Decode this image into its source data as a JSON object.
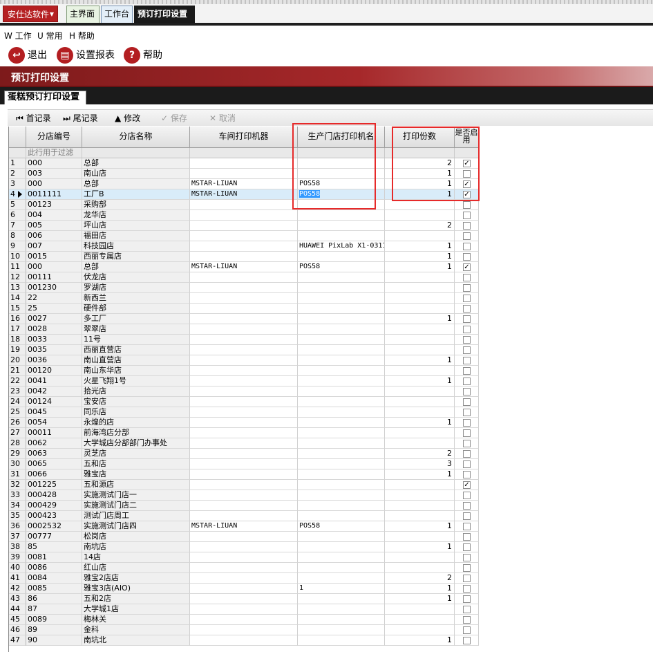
{
  "app": {
    "brand": "安仕达软件",
    "tabs": [
      "主界面",
      "工作台",
      "预订打印设置"
    ]
  },
  "menu": [
    "W 工作",
    "U 常用",
    "H 帮助"
  ],
  "toolbar": {
    "exit": "退出",
    "settings": "设置报表",
    "help": "帮助"
  },
  "page_title": "预订打印设置",
  "subtab": "蛋糕预订打印设置",
  "grid_toolbar": {
    "first": "首记录",
    "last": "尾记录",
    "edit": "修改",
    "save": "保存",
    "cancel": "取消"
  },
  "columns": {
    "code": "分店编号",
    "name": "分店名称",
    "workshop": "车间打印机器",
    "store": "生产门店打印机名",
    "copies": "打印份数",
    "enabled": "是否启用"
  },
  "filter_hint": "此行用于过滤",
  "colors": {
    "brand": "#b52022",
    "title_bar": "#8b1f20",
    "selection": "#d9ecf9",
    "highlight_box": "#e62a2a"
  },
  "rows": [
    {
      "i": "1",
      "code": "000",
      "name": "总部",
      "wp": "",
      "sp": "",
      "cnt": "2",
      "en": true
    },
    {
      "i": "2",
      "code": "003",
      "name": "南山店",
      "wp": "",
      "sp": "",
      "cnt": "1",
      "en": false
    },
    {
      "i": "3",
      "code": "000",
      "name": "总部",
      "wp": "MSTAR-LIUAN",
      "sp": "POS58",
      "cnt": "1",
      "en": true
    },
    {
      "i": "4",
      "code": "0011111",
      "name": "工厂B",
      "wp": "MSTAR-LIUAN",
      "sp": "POS58",
      "cnt": "1",
      "en": true
    },
    {
      "i": "5",
      "code": "00123",
      "name": "采购部",
      "wp": "",
      "sp": "",
      "cnt": "",
      "en": false
    },
    {
      "i": "6",
      "code": "004",
      "name": "龙华店",
      "wp": "",
      "sp": "",
      "cnt": "",
      "en": false
    },
    {
      "i": "7",
      "code": "005",
      "name": "坪山店",
      "wp": "",
      "sp": "",
      "cnt": "2",
      "en": false
    },
    {
      "i": "8",
      "code": "006",
      "name": "福田店",
      "wp": "",
      "sp": "",
      "cnt": "",
      "en": false
    },
    {
      "i": "9",
      "code": "007",
      "name": "科技园店",
      "wp": "",
      "sp": "HUAWEI PixLab X1-0311",
      "cnt": "1",
      "en": false
    },
    {
      "i": "10",
      "code": "0015",
      "name": "西丽专属店",
      "wp": "",
      "sp": "",
      "cnt": "1",
      "en": false
    },
    {
      "i": "11",
      "code": "000",
      "name": "总部",
      "wp": "MSTAR-LIUAN",
      "sp": "POS58",
      "cnt": "1",
      "en": true
    },
    {
      "i": "12",
      "code": "00111",
      "name": "伏龙店",
      "wp": "",
      "sp": "",
      "cnt": "",
      "en": false
    },
    {
      "i": "13",
      "code": "001230",
      "name": "罗湖店",
      "wp": "",
      "sp": "",
      "cnt": "",
      "en": false
    },
    {
      "i": "14",
      "code": "22",
      "name": "新西兰",
      "wp": "",
      "sp": "",
      "cnt": "",
      "en": false
    },
    {
      "i": "15",
      "code": "25",
      "name": "硬件部",
      "wp": "",
      "sp": "",
      "cnt": "",
      "en": false
    },
    {
      "i": "16",
      "code": "0027",
      "name": "多工厂",
      "wp": "",
      "sp": "",
      "cnt": "1",
      "en": false
    },
    {
      "i": "17",
      "code": "0028",
      "name": "翠翠店",
      "wp": "",
      "sp": "",
      "cnt": "",
      "en": false
    },
    {
      "i": "18",
      "code": "0033",
      "name": "11号",
      "wp": "",
      "sp": "",
      "cnt": "",
      "en": false
    },
    {
      "i": "19",
      "code": "0035",
      "name": "西丽直营店",
      "wp": "",
      "sp": "",
      "cnt": "",
      "en": false
    },
    {
      "i": "20",
      "code": "0036",
      "name": "南山直营店",
      "wp": "",
      "sp": "",
      "cnt": "1",
      "en": false
    },
    {
      "i": "21",
      "code": "00120",
      "name": "南山东华店",
      "wp": "",
      "sp": "",
      "cnt": "",
      "en": false
    },
    {
      "i": "22",
      "code": "0041",
      "name": "火星飞翔1号",
      "wp": "",
      "sp": "",
      "cnt": "1",
      "en": false
    },
    {
      "i": "23",
      "code": "0042",
      "name": "拾光店",
      "wp": "",
      "sp": "",
      "cnt": "",
      "en": false
    },
    {
      "i": "24",
      "code": "00124",
      "name": "宝安店",
      "wp": "",
      "sp": "",
      "cnt": "",
      "en": false
    },
    {
      "i": "25",
      "code": "0045",
      "name": "同乐店",
      "wp": "",
      "sp": "",
      "cnt": "",
      "en": false
    },
    {
      "i": "26",
      "code": "0054",
      "name": "永煌的店",
      "wp": "",
      "sp": "",
      "cnt": "1",
      "en": false
    },
    {
      "i": "27",
      "code": "00011",
      "name": "前海湾店分部",
      "wp": "",
      "sp": "",
      "cnt": "",
      "en": false
    },
    {
      "i": "28",
      "code": "0062",
      "name": "大学城店分部部门办事处",
      "wp": "",
      "sp": "",
      "cnt": "",
      "en": false
    },
    {
      "i": "29",
      "code": "0063",
      "name": "灵芝店",
      "wp": "",
      "sp": "",
      "cnt": "2",
      "en": false
    },
    {
      "i": "30",
      "code": "0065",
      "name": "五和店",
      "wp": "",
      "sp": "",
      "cnt": "3",
      "en": false
    },
    {
      "i": "31",
      "code": "0066",
      "name": "雅宝店",
      "wp": "",
      "sp": "",
      "cnt": "1",
      "en": false
    },
    {
      "i": "32",
      "code": "001225",
      "name": "五和源店",
      "wp": "",
      "sp": "",
      "cnt": "",
      "en": true
    },
    {
      "i": "33",
      "code": "000428",
      "name": "实施测试门店一",
      "wp": "",
      "sp": "",
      "cnt": "",
      "en": false
    },
    {
      "i": "34",
      "code": "000429",
      "name": "实施测试门店二",
      "wp": "",
      "sp": "",
      "cnt": "",
      "en": false
    },
    {
      "i": "35",
      "code": "000423",
      "name": "测试门店周工",
      "wp": "",
      "sp": "",
      "cnt": "",
      "en": false
    },
    {
      "i": "36",
      "code": "0002532",
      "name": "实施测试门店四",
      "wp": "MSTAR-LIUAN",
      "sp": "POS58",
      "cnt": "1",
      "en": false
    },
    {
      "i": "37",
      "code": "00777",
      "name": "松岗店",
      "wp": "",
      "sp": "",
      "cnt": "",
      "en": false
    },
    {
      "i": "38",
      "code": "85",
      "name": "南坑店",
      "wp": "",
      "sp": "",
      "cnt": "1",
      "en": false
    },
    {
      "i": "39",
      "code": "0081",
      "name": "14店",
      "wp": "",
      "sp": "",
      "cnt": "",
      "en": false
    },
    {
      "i": "40",
      "code": "0086",
      "name": "红山店",
      "wp": "",
      "sp": "",
      "cnt": "",
      "en": false
    },
    {
      "i": "41",
      "code": "0084",
      "name": "雅宝2店店",
      "wp": "",
      "sp": "",
      "cnt": "2",
      "en": false
    },
    {
      "i": "42",
      "code": "0085",
      "name": "雅宝3店(AIO)",
      "wp": "",
      "sp": "1",
      "cnt": "1",
      "en": false
    },
    {
      "i": "43",
      "code": "86",
      "name": "五和2店",
      "wp": "",
      "sp": "",
      "cnt": "1",
      "en": false
    },
    {
      "i": "44",
      "code": "87",
      "name": "大学城1店",
      "wp": "",
      "sp": "",
      "cnt": "",
      "en": false
    },
    {
      "i": "45",
      "code": "0089",
      "name": "梅林关",
      "wp": "",
      "sp": "",
      "cnt": "",
      "en": false
    },
    {
      "i": "46",
      "code": "89",
      "name": "金科",
      "wp": "",
      "sp": "",
      "cnt": "",
      "en": false
    },
    {
      "i": "47",
      "code": "90",
      "name": "南坑北",
      "wp": "",
      "sp": "",
      "cnt": "1",
      "en": false
    }
  ]
}
